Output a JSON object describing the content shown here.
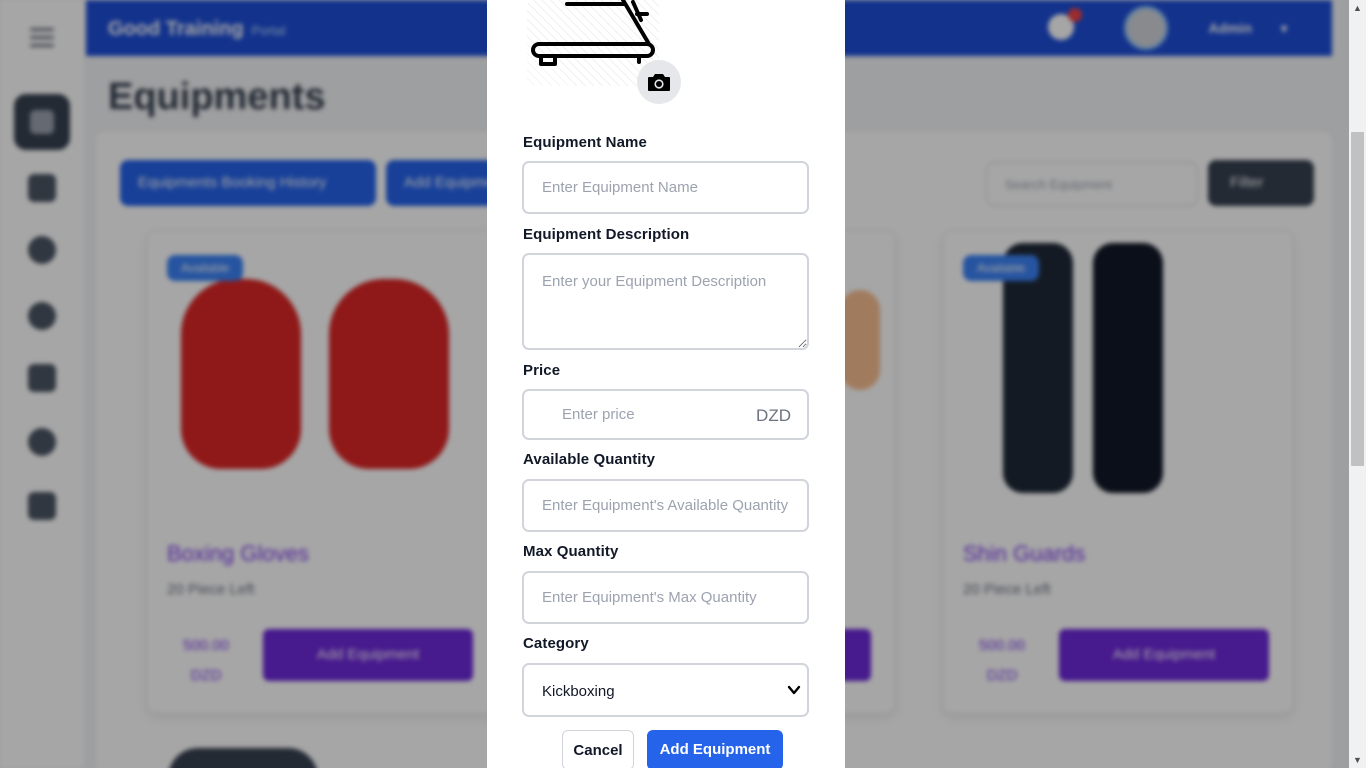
{
  "app": {
    "brand": "Good Training",
    "brand_sub": "Portal",
    "user_name": "Admin"
  },
  "page": {
    "title": "Equipments",
    "booking_history_label": "Equipments Booking History",
    "add_equipment_label": "Add Equipment",
    "search_placeholder": "Search Equipment",
    "filter_label": "Filter"
  },
  "cards": [
    {
      "badge": "Available",
      "name": "Boxing Gloves",
      "left": "20 Piece Left",
      "price": "500.00 DZD",
      "button": "Add Equipment"
    },
    {
      "badge": "Available",
      "name": "Shin Guards",
      "left": "20 Piece Left",
      "price": "500.00 DZD",
      "button": "Add Equipment"
    }
  ],
  "form": {
    "name_label": "Equipment Name",
    "name_placeholder": "Enter Equipment Name",
    "description_label": "Equipment Description",
    "description_placeholder": "Enter your Equipment Description",
    "price_label": "Price",
    "price_placeholder": "Enter price",
    "currency": "DZD",
    "available_label": "Available Quantity",
    "available_placeholder": "Enter Equipment's Available Quantity",
    "max_label": "Max Quantity",
    "max_placeholder": "Enter Equipment's Max Quantity",
    "category_label": "Category",
    "category_value": "Kickboxing",
    "cancel_label": "Cancel",
    "submit_label": "Add Equipment"
  },
  "icons": {
    "image_placeholder": "treadmill-icon",
    "upload": "camera-icon",
    "select_arrow": "chevron-down-icon"
  },
  "colors": {
    "primary": "#2563eb",
    "topbar": "#1d4ed8",
    "accent_purple": "#6d28d9"
  }
}
